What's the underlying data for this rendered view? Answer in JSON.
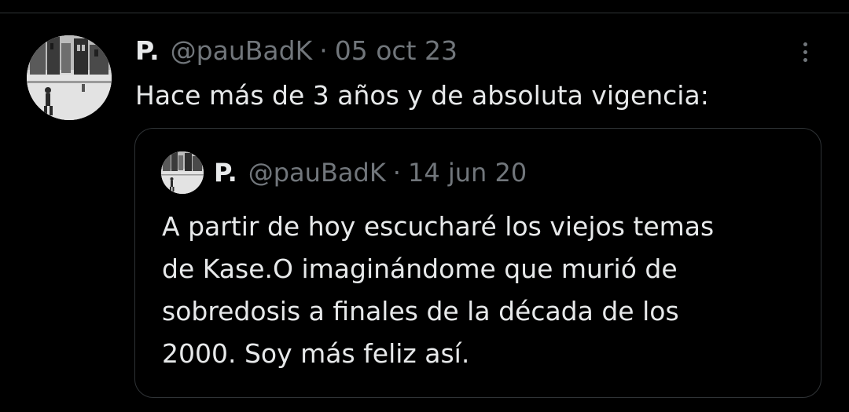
{
  "tweet": {
    "display_name": "P.",
    "handle": "@pauBadK",
    "separator": "·",
    "date": "05 oct 23",
    "text": "Hace más de 3 años y de absoluta vigencia:"
  },
  "quoted_tweet": {
    "display_name": "P.",
    "handle": "@pauBadK",
    "separator": "·",
    "date": "14 jun 20",
    "text_lines": [
      "A partir de hoy escucharé los viejos temas",
      "de Kase.O imaginándome que murió de",
      "sobredosis a finales de la década de los",
      "2000. Soy más feliz así."
    ]
  },
  "icons": {
    "more": "more-options-icon",
    "avatar": "black-and-white-street-photo"
  },
  "colors": {
    "background": "#000000",
    "text": "#e7e9ea",
    "muted": "#71767b",
    "border": "#2f3336"
  }
}
